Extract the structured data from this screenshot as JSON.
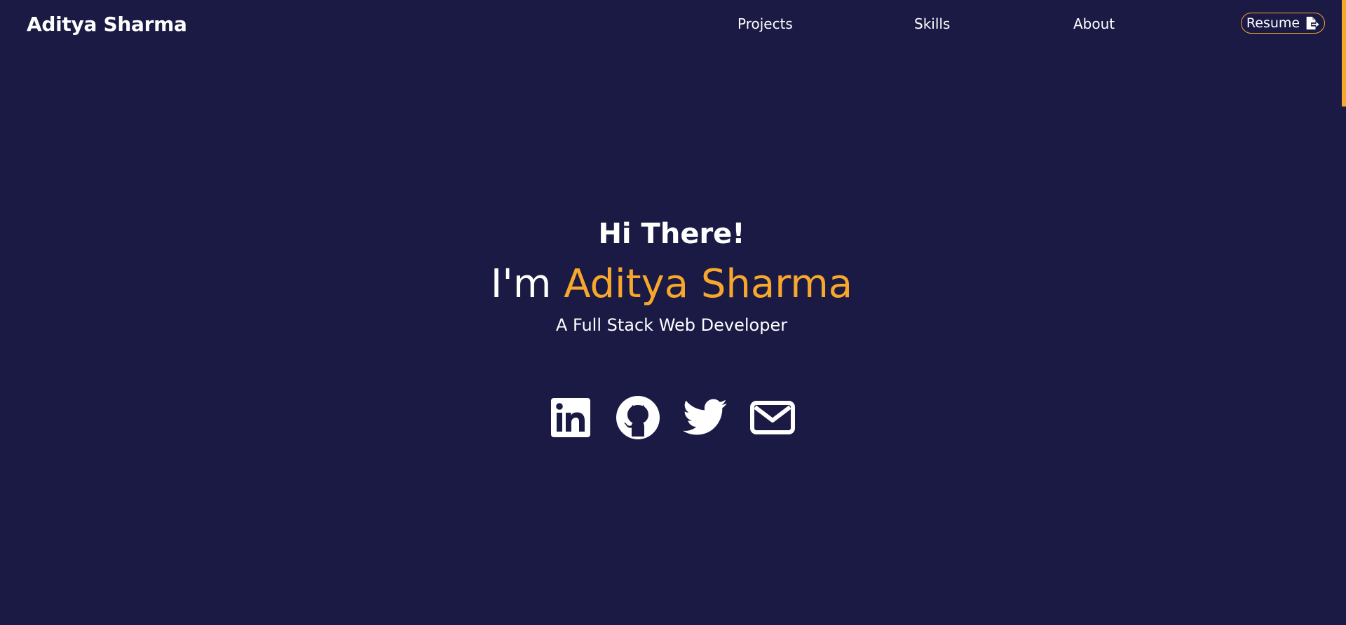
{
  "colors": {
    "background": "#1a1a45",
    "accent": "#f7a72b",
    "text": "#ffffff"
  },
  "navbar": {
    "brand": "Aditya Sharma",
    "links": [
      {
        "label": "Projects"
      },
      {
        "label": "Skills"
      },
      {
        "label": "About"
      }
    ],
    "resume": {
      "label": "Resume",
      "icon": "file-export-icon"
    }
  },
  "hero": {
    "greeting": "Hi There!",
    "headline_prefix": "I'm",
    "headline_name": "Aditya Sharma",
    "subtitle": "A Full Stack Web Developer"
  },
  "socials": [
    {
      "icon": "linkedin-icon"
    },
    {
      "icon": "github-icon"
    },
    {
      "icon": "twitter-icon"
    },
    {
      "icon": "email-icon"
    }
  ],
  "scroll_progress": 0.17
}
